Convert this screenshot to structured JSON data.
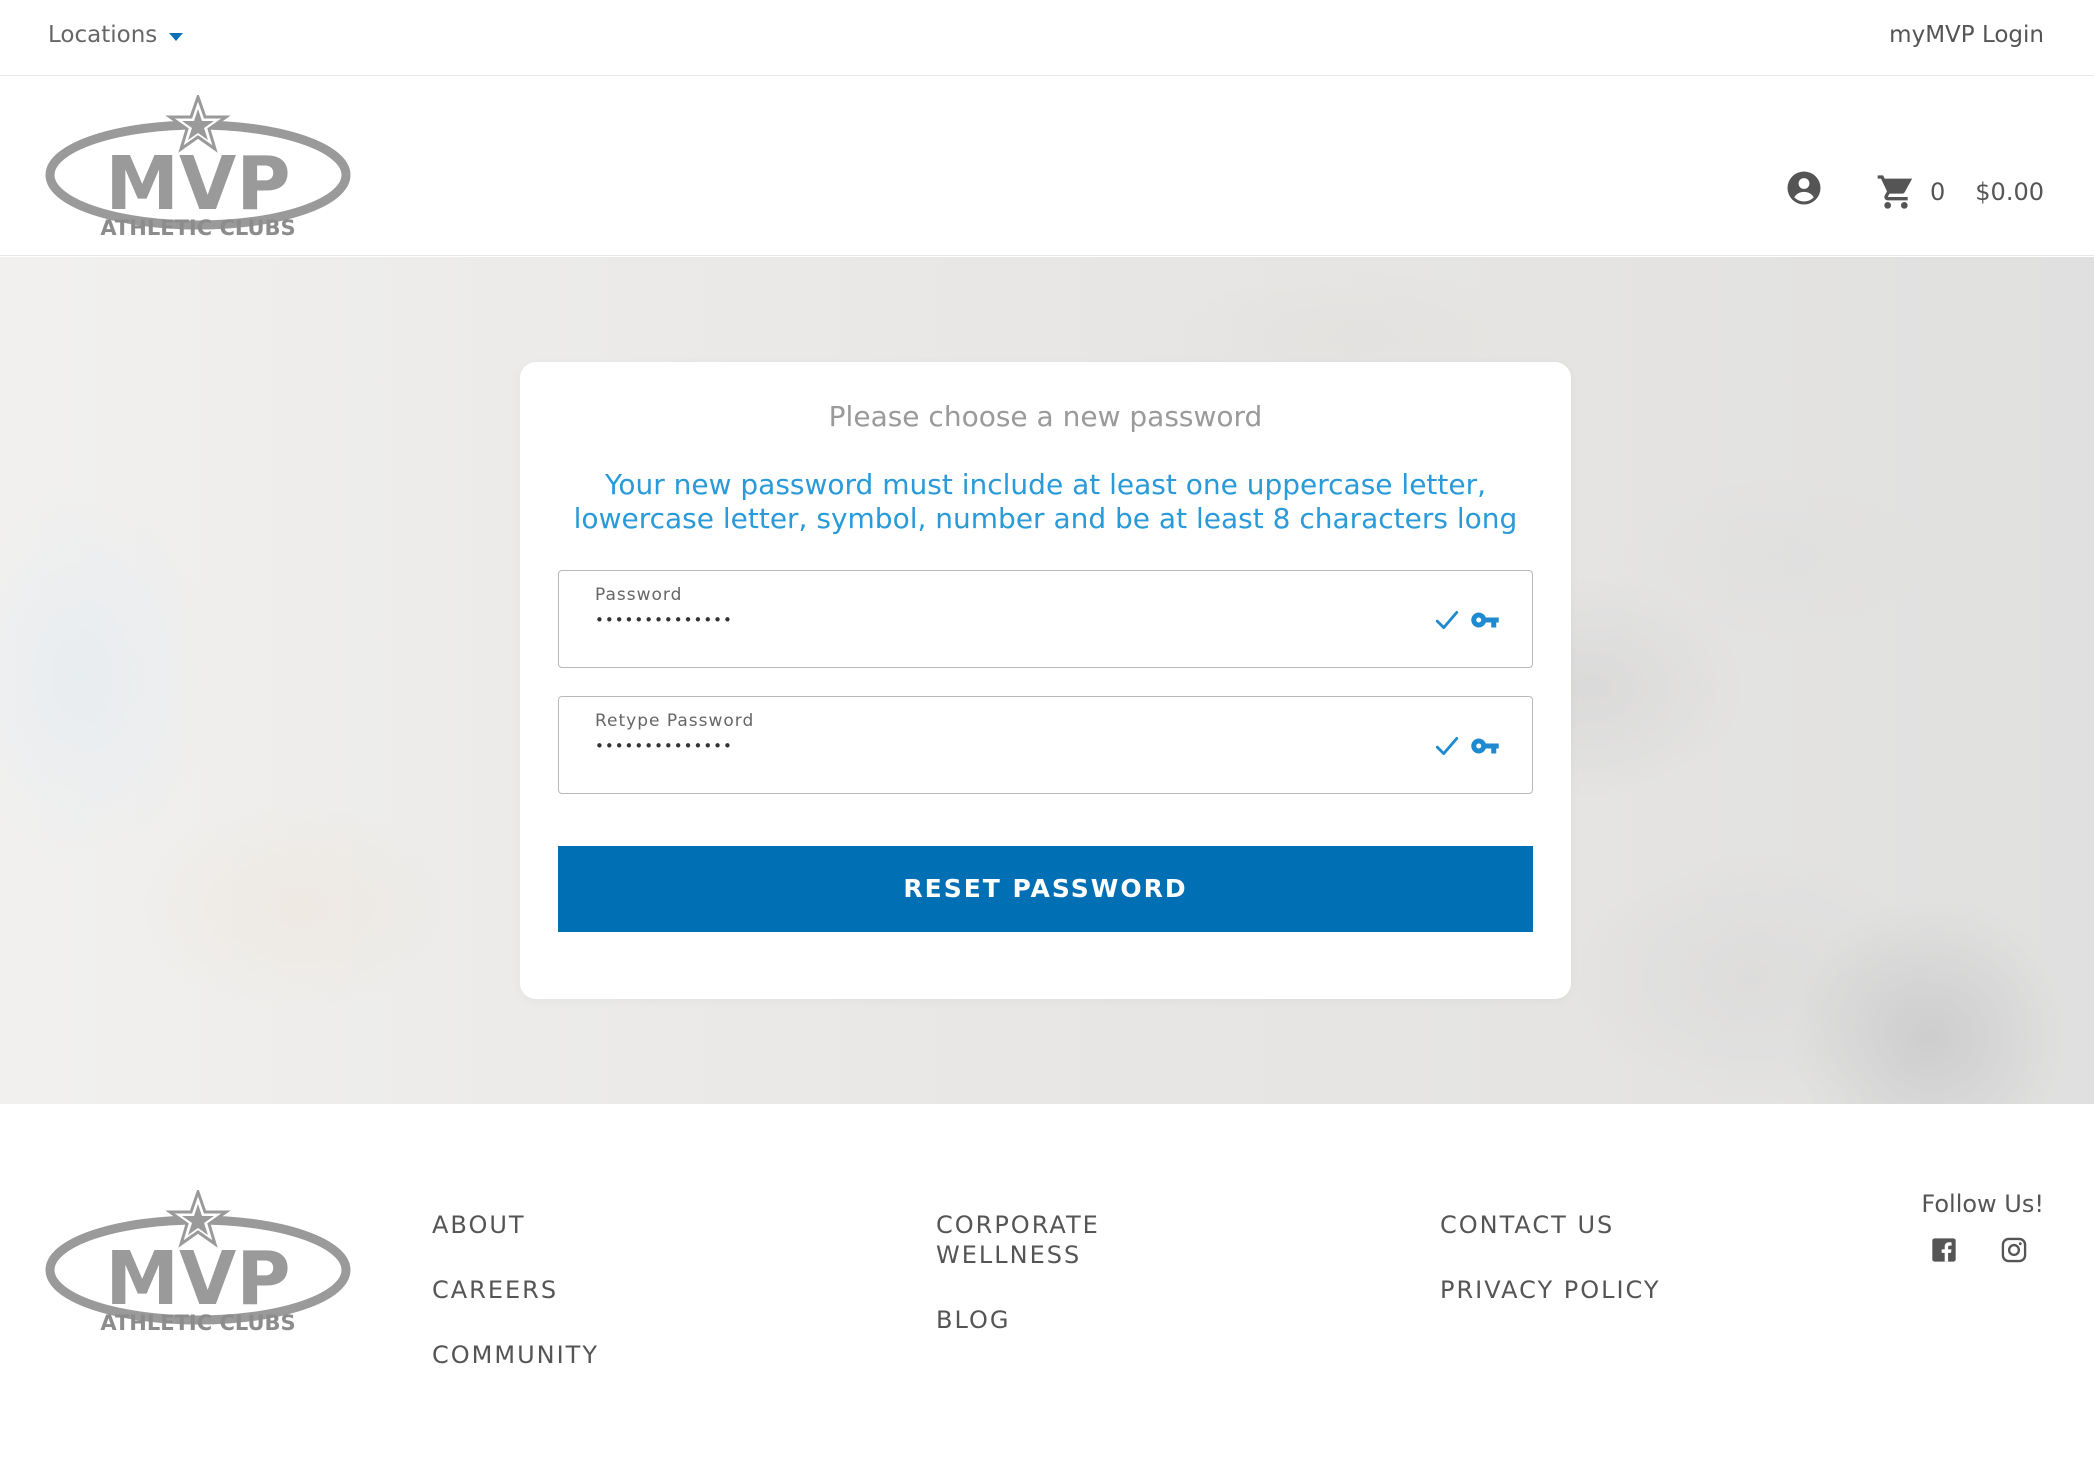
{
  "topbar": {
    "locations_label": "Locations",
    "login_label": "myMVP Login"
  },
  "brand": {
    "logo_text": "MVP",
    "logo_subtext": "ATHLETIC CLUBS"
  },
  "header": {
    "cart_count": "0",
    "cart_total": "$0.00"
  },
  "card": {
    "title": "Please choose a new password",
    "rules": "Your new password must include at least one uppercase letter, lowercase letter, symbol, number and be at least 8 characters long",
    "password": {
      "label": "Password",
      "value": "••••••••••••••"
    },
    "retype": {
      "label": "Retype Password",
      "value": "••••••••••••••"
    },
    "button_label": "RESET PASSWORD"
  },
  "footer": {
    "col1": [
      "ABOUT",
      "CAREERS",
      "COMMUNITY"
    ],
    "col2": [
      "CORPORATE WELLNESS",
      "BLOG"
    ],
    "col3": [
      "CONTACT US",
      "PRIVACY POLICY"
    ],
    "follow_label": "Follow Us!"
  },
  "colors": {
    "accent": "#006fb3",
    "rules_text": "#2a9ad8",
    "logo_gray": "#9a9a9a"
  },
  "icons": [
    "chevron-down-icon",
    "user-account-icon",
    "shopping-cart-icon",
    "checkmark-icon",
    "key-icon",
    "facebook-icon",
    "instagram-icon"
  ]
}
